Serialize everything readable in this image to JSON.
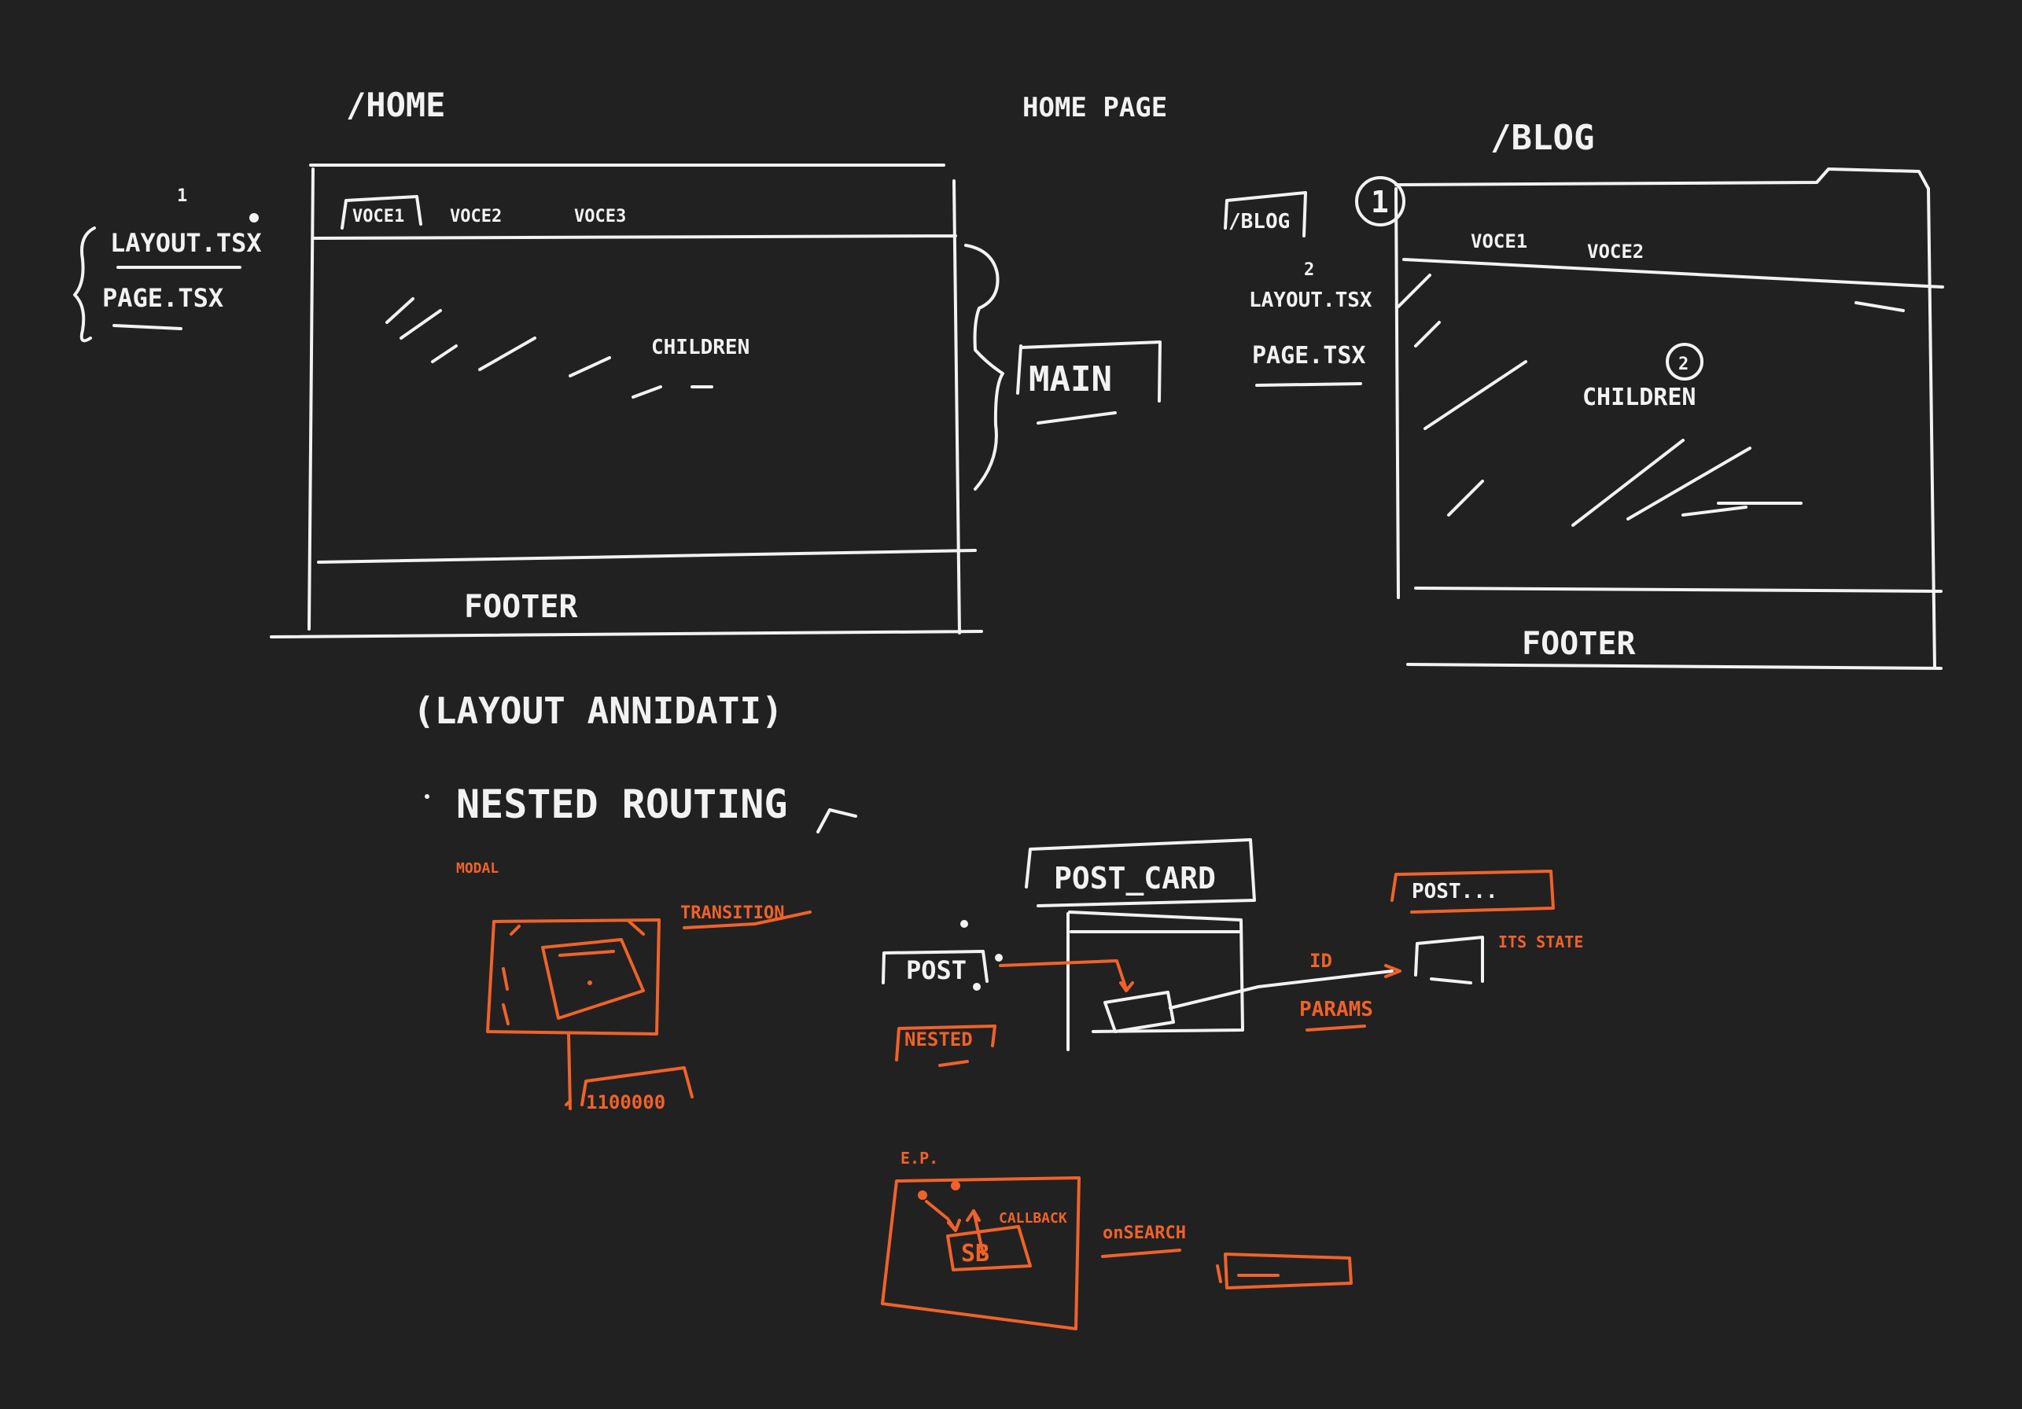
{
  "colors": {
    "background": "#212121",
    "ink": "#f2f2f2",
    "accent": "#f0622a"
  },
  "home": {
    "route": "/HOME",
    "file_one": "LAYOUT.TSX",
    "file_one_num": "1",
    "file_two": "PAGE.TSX",
    "nav_item_1": "VOCE1",
    "nav_item_2": "VOCE2",
    "nav_item_3": "VOCE3",
    "children": "CHILDREN",
    "footer": "FOOTER"
  },
  "main_label": "MAIN",
  "home_page_label": "HOME PAGE",
  "blog": {
    "route": "/BLOG",
    "folder": "/BLOG",
    "num_one": "1",
    "num_two": "2",
    "file_one": "LAYOUT.TSX",
    "file_two": "PAGE.TSX",
    "nav_item_1": "VOCE1",
    "nav_item_2": "VOCE2",
    "children": "CHILDREN",
    "children_num": "2",
    "footer": "FOOTER"
  },
  "notes": {
    "line_1": "(LAYOUT ANNIDATI)",
    "line_2": "NESTED ROUTING"
  },
  "orange": {
    "modal_label": "MODAL",
    "transition": "TRANSITION",
    "counter": "1100000",
    "nested": "NESTED",
    "params": "PARAMS",
    "post_right": "POST...",
    "its_state": "ITS STATE",
    "id_label": "ID",
    "ep_label": "E.P.",
    "callback": "CALLBACK",
    "sb": "SB",
    "on_search": "onSEARCH"
  },
  "white_small": {
    "post_card": "POST_CARD",
    "post": "POST"
  }
}
